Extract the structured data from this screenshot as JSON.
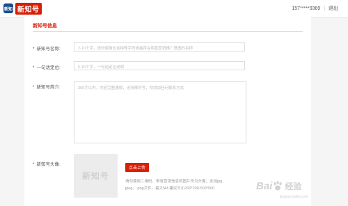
{
  "header": {
    "logo_badge": "新知",
    "logo_text": "新知号",
    "phone": "157*****9369",
    "separator": "|",
    "logout_label": "退出"
  },
  "section": {
    "title": "新知号信息"
  },
  "form": {
    "name": {
      "required_mark": "*",
      "label": "新知号名称:",
      "placeholder": "2-10个字，请勿使用包含特殊字符或者存在明显营销推广意图的名称"
    },
    "category": {
      "required_mark": "*",
      "label": "一句话定位:",
      "placeholder": "5-15个字，一句话定位说明"
    },
    "intro": {
      "required_mark": "*",
      "label": "新知号简介:",
      "placeholder": "300字以内，内容完整通顺，无特殊符号，勿添加任何联系方式"
    },
    "avatar": {
      "required_mark": "*",
      "label": "新知号头像:",
      "placeholder_text": "新知号",
      "upload_label": "点击上传",
      "hint_line1": "请勿使用二维码、带有营销信息的图片作为头像，支持jpg,",
      "hint_line2": "jpeg、.png文件，最大5M 建议大小200*200-500*500"
    }
  },
  "watermark": {
    "text_left": "Bai",
    "text_right": "经验",
    "sub": "jingyan.baidu.com"
  },
  "colors": {
    "accent": "#d81e06",
    "brand_blue": "#1a4b8c"
  }
}
